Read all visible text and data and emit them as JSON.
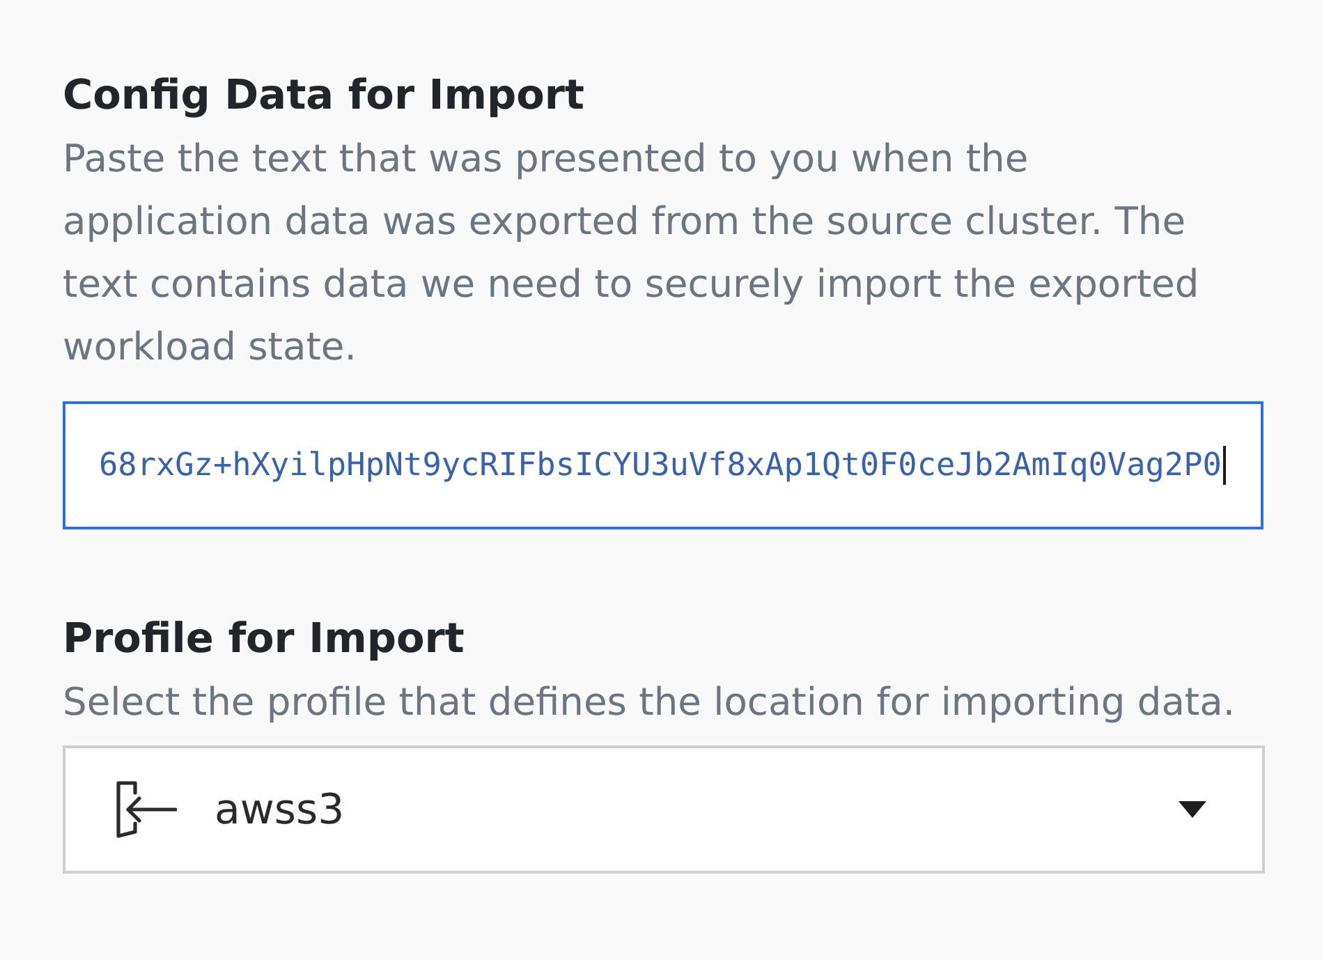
{
  "config_section": {
    "title": "Config Data for Import",
    "description": "Paste the text that was presented to you when the application data was exported from the source cluster. The text contains data we need to securely import the exported workload state.",
    "field": {
      "value": "68rxGz+hXyilpHpNt9ycRIFbsICYU3uVf8xAp1Qt0F0ceJb2AmIq0Vag2P0",
      "focused": true
    }
  },
  "profile_section": {
    "title": "Profile for Import",
    "description": "Select the profile that defines the location for importing data.",
    "select": {
      "value": "awss3",
      "expanded": false
    }
  }
}
